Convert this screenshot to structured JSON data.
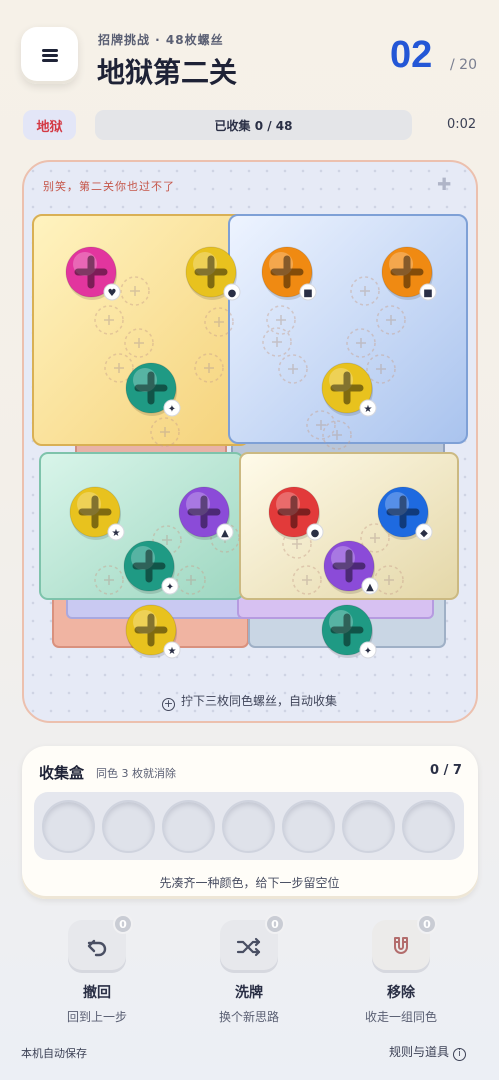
{
  "header": {
    "menu_icon": "hamburger-icon",
    "subtitle": "招牌挑战 · 48枚螺丝",
    "title": "地狱第二关",
    "level_number": "02",
    "level_total": "/ 20"
  },
  "status": {
    "difficulty": "地狱",
    "progress_label": "已收集 0 / 48",
    "progress_fraction": 0,
    "timer": "0:02"
  },
  "board": {
    "hint": "别笑，第二关你也过不了",
    "plus_icon": "plus-icon",
    "footer_hint": "拧下三枚同色螺丝，自动收集",
    "colors": {
      "pink": "#e2359e",
      "yellow": "#e8c21e",
      "teal": "#1f9a84",
      "orange": "#f08a12",
      "purple": "#8b4bd8",
      "red": "#e23a3a",
      "blue": "#1e6ae0"
    },
    "screws": [
      {
        "color": "pink",
        "mark": "heart"
      },
      {
        "color": "yellow",
        "mark": "circle"
      },
      {
        "color": "teal",
        "mark": "sparkle"
      },
      {
        "color": "orange",
        "mark": "square"
      },
      {
        "color": "orange",
        "mark": "square"
      },
      {
        "color": "yellow",
        "mark": "star"
      },
      {
        "color": "yellow",
        "mark": "star"
      },
      {
        "color": "purple",
        "mark": "triangle"
      },
      {
        "color": "teal",
        "mark": "sparkle"
      },
      {
        "color": "red",
        "mark": "circle"
      },
      {
        "color": "blue",
        "mark": "diamond"
      },
      {
        "color": "purple",
        "mark": "triangle"
      },
      {
        "color": "yellow",
        "mark": "star"
      },
      {
        "color": "teal",
        "mark": "sparkle"
      }
    ]
  },
  "collect_box": {
    "title": "收集盒",
    "subtitle": "同色 3 枚就消除",
    "count": "0 / 7",
    "slots": 7,
    "footer": "先凑齐一种颜色，给下一步留空位"
  },
  "tools": [
    {
      "icon": "undo-icon",
      "badge": "0",
      "label": "撤回",
      "sub": "回到上一步"
    },
    {
      "icon": "shuffle-icon",
      "badge": "0",
      "label": "洗牌",
      "sub": "换个新思路"
    },
    {
      "icon": "magnet-icon",
      "badge": "0",
      "label": "移除",
      "sub": "收走一组同色"
    }
  ],
  "footer": {
    "autosave": "本机自动保存",
    "rules": "规则与道具"
  }
}
